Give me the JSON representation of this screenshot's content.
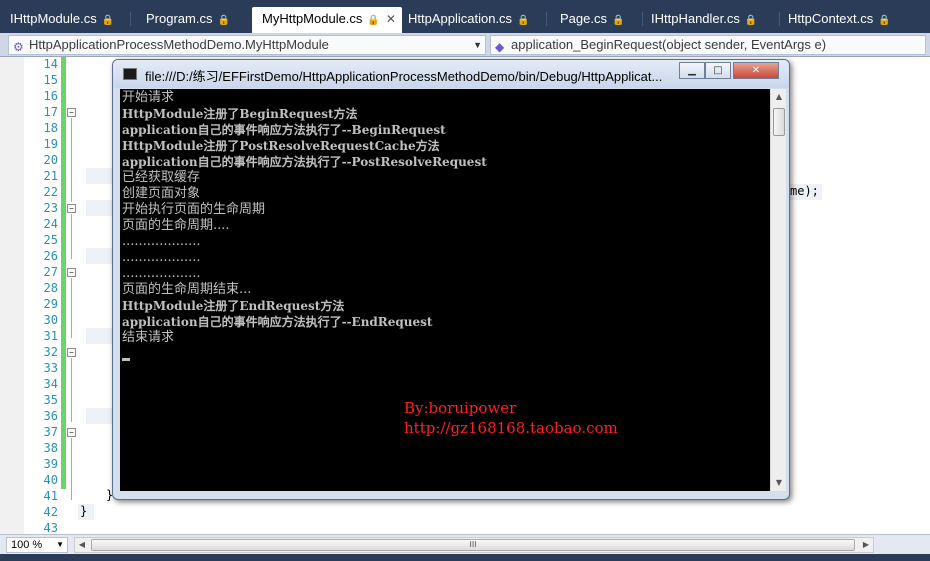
{
  "tabs": [
    {
      "label": "IHttpModule.cs",
      "pinned": true
    },
    {
      "label": "Program.cs",
      "pinned": true
    },
    {
      "label": "MyHttpModule.cs",
      "pinned": true,
      "active": true
    },
    {
      "label": "HttpApplication.cs",
      "pinned": true
    },
    {
      "label": "Page.cs",
      "pinned": true
    },
    {
      "label": "IHttpHandler.cs",
      "pinned": true
    },
    {
      "label": "HttpContext.cs",
      "pinned": true
    }
  ],
  "tab_close_glyph": "✕",
  "nav": {
    "type_combo": "HttpApplicationProcessMethodDemo.MyHttpModule",
    "member_combo": "application_BeginRequest(object sender, EventArgs e)"
  },
  "editor": {
    "line_numbers": [
      "14",
      "15",
      "16",
      "17",
      "18",
      "19",
      "20",
      "21",
      "22",
      "23",
      "24",
      "25",
      "26",
      "27",
      "28",
      "29",
      "30",
      "31",
      "32",
      "33",
      "34",
      "35",
      "36",
      "37",
      "38",
      "39",
      "40",
      "41",
      "42",
      "43"
    ],
    "visible_code": {
      "line_22_tail": "me);",
      "line_41": "}",
      "line_42": "}"
    }
  },
  "console": {
    "title": "file:///D:/练习/EFFirstDemo/HttpApplicationProcessMethodDemo/bin/Debug/HttpApplicat...",
    "lines": [
      {
        "text": "开始请求",
        "bold": false
      },
      {
        "text": "HttpModule注册了BeginRequest方法",
        "bold": true
      },
      {
        "text": "application自己的事件响应方法执行了--BeginRequest",
        "bold": true
      },
      {
        "text": "HttpModule注册了PostResolveRequestCache方法",
        "bold": true
      },
      {
        "text": "application自己的事件响应方法执行了--PostResolveRequest",
        "bold": true
      },
      {
        "text": "已经获取缓存",
        "bold": false
      },
      {
        "text": "创建页面对象",
        "bold": false
      },
      {
        "text": "开始执行页面的生命周期",
        "bold": false
      },
      {
        "text": "页面的生命周期....",
        "bold": false
      },
      {
        "text": "...................",
        "bold": false
      },
      {
        "text": "...................",
        "bold": false
      },
      {
        "text": "...................",
        "bold": false
      },
      {
        "text": "页面的生命周期结束...",
        "bold": false
      },
      {
        "text": "HttpModule注册了EndRequest方法",
        "bold": true
      },
      {
        "text": "application自己的事件响应方法执行了--EndRequest",
        "bold": true
      },
      {
        "text": "结束请求",
        "bold": false
      }
    ],
    "watermark": [
      "By:boruipower",
      "http://gz168168.taobao.com"
    ],
    "colors": {
      "background": "#000000",
      "text": "#c0c0c0",
      "watermark": "#ff2020"
    }
  },
  "bottom": {
    "zoom": "100 %",
    "hscroll_grip": "III"
  },
  "colors": {
    "chrome": "#2b3c59",
    "line_number": "#2b91af",
    "change_bar": "#6ad36a"
  }
}
